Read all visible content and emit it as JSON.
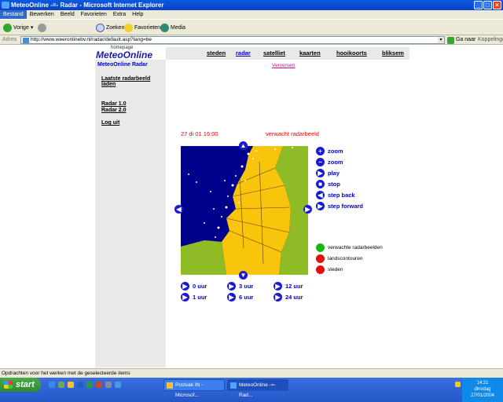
{
  "window": {
    "title": "MeteoOnline -=- Radar - Microsoft Internet Explorer"
  },
  "menu": [
    "Bestand",
    "Bewerken",
    "Beeld",
    "Favorieten",
    "Extra",
    "Help"
  ],
  "toolbar": {
    "back": "Vorige",
    "search": "Zoeken",
    "favorites": "Favorieten",
    "media": "Media"
  },
  "address": {
    "label": "Adres",
    "url": "http://www.weeronlinebv.nl/radar/default.asp?lang=be",
    "go": "Ga naar",
    "links": "Koppelingen"
  },
  "site": {
    "homepage_label": "homepage",
    "logo": "MeteoOnline",
    "section_title": "MeteoOnline Radar",
    "nav": [
      "steden",
      "radar",
      "satelliet",
      "kaarten",
      "hooikoorts",
      "bliksem"
    ],
    "active_nav": "radar",
    "sidebar": {
      "latest_1": "Laatste radarbeeld",
      "latest_2": "laden",
      "radar1": "Radar 1.0",
      "radar2": "Radar 2.0",
      "logout": "Log uit"
    },
    "refresh": "Verversen",
    "timestamp": "27 di 01 16:00",
    "forecast_label": "verwacht radarbeeld",
    "controls": [
      "zoom",
      "zoom",
      "play",
      "stop",
      "step back",
      "step forward"
    ],
    "time_buttons": [
      "0 uur",
      "3 uur",
      "12 uur",
      "1 uur",
      "6 uur",
      "24 uur"
    ],
    "legend": [
      {
        "label": "verwachte radarbeelden",
        "color": "#18b818"
      },
      {
        "label": "landscontouren",
        "color": "#e01010"
      },
      {
        "label": "steden",
        "color": "#e01010"
      }
    ]
  },
  "status": "Opdrachten voor het werken met de geselecteerde items",
  "taskbar": {
    "start": "start",
    "tasks": [
      "Postvak IN - Microsof...",
      "MeteoOnline -=- Rad..."
    ],
    "clock": "14:21",
    "day": "dinsdag",
    "date": "27/01/2004"
  },
  "colors": {
    "sea": "#00008b",
    "land_nl": "#f9c40c",
    "land_other": "#8fbc25",
    "accent": "#0000cc"
  }
}
